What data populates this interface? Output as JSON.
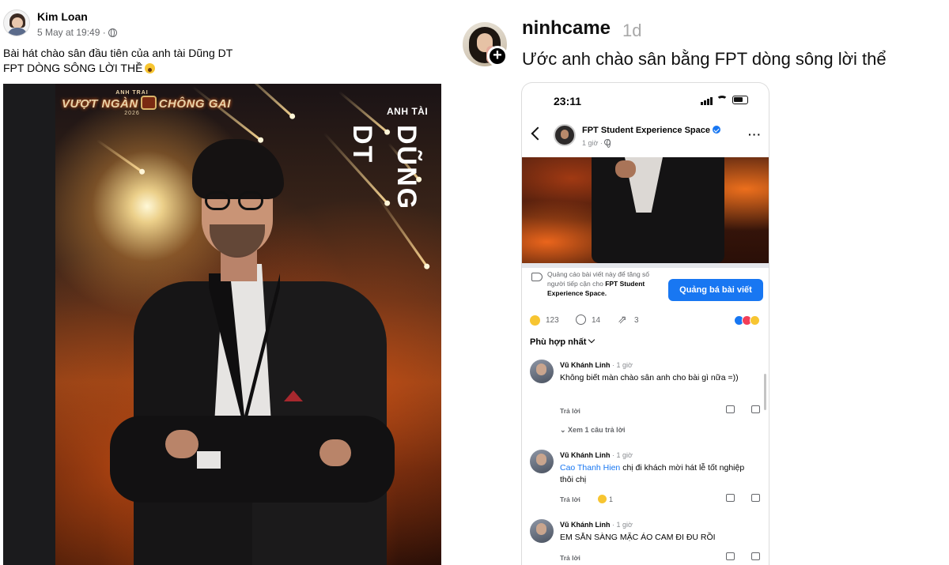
{
  "fb_post": {
    "author": "Kim Loan",
    "timestamp": "5 May at 19:49 ·",
    "visibility_icon": "globe-icon",
    "text_line1": "Bài hát chào sân đầu tiên của anh tài Dũng DT",
    "text_line2": "FPT DÒNG SÔNG LỜI THỀ",
    "emoji": "astonished-face-emoji",
    "poster": {
      "show_logo_top": "ANH TRAI",
      "show_logo_main_a": "VƯỢT NGÀN",
      "show_logo_main_b": "CHÔNG GAI",
      "show_logo_year": "2026",
      "label": "ANH TÀI",
      "artist_name": "DŨNG DT"
    }
  },
  "tiktok_comment": {
    "username": "ninhcame",
    "time": "1d",
    "text": "Ước anh chào sân bằng FPT dòng sông lời thể",
    "follow_icon": "plus-icon"
  },
  "phone": {
    "status_time": "23:11",
    "page_name": "FPT Student Experience Space",
    "page_time": "1 giờ ·",
    "promo_text": "Quảng cáo bài viết này để tăng số người tiếp cận cho",
    "promo_page": "FPT Student Experience Space.",
    "boost_button": "Quảng bá bài viết",
    "reaction_count": "123",
    "comment_count": "14",
    "share_count": "3",
    "sort_label": "Phù hợp nhất",
    "comments": [
      {
        "author": "Vũ Khánh Linh",
        "time": "· 1 giờ",
        "text": "Không biết màn chào sân anh cho bài gì nữa =))",
        "reply_label": "Trả lời",
        "view_replies": "Xem 1 câu trả lời"
      },
      {
        "author": "Vũ Khánh Linh",
        "time": "· 1 giờ",
        "mention": "Cao Thanh Hien",
        "text": " chị đi khách mời hát lễ tốt nghiệp thôi chị",
        "reply_label": "Trả lời",
        "reaction_count": "1"
      },
      {
        "author": "Vũ Khánh Linh",
        "time": "· 1 giờ",
        "text": "EM SẴN SÀNG MẶC ÁO CAM ĐI ĐU RỒI",
        "reply_label": "Trả lời"
      }
    ],
    "colors": {
      "accent": "#1877f2",
      "muted": "#65676b"
    }
  }
}
